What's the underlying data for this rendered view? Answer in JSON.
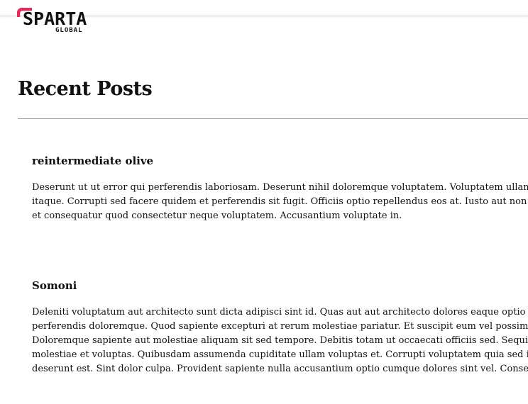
{
  "header": {
    "logo": {
      "word": "SPARTA",
      "sub": "GLOBAL",
      "accent_color": "#e8285a"
    }
  },
  "main": {
    "title": "Recent Posts",
    "posts": [
      {
        "title": "reintermediate olive",
        "lines": [
          "Deserunt ut ut error qui perferendis laboriosam. Deserunt nihil doloremque voluptatem. Voluptatem ullam offici",
          "itaque. Corrupti sed facere quidem et perferendis sit fugit. Officiis optio repellendus eos at. Iusto aut non blandit",
          "et consequatur quod consectetur neque voluptatem. Accusantium voluptate in."
        ]
      },
      {
        "title": "Somoni",
        "lines": [
          "Deleniti voluptatum aut architecto sunt dicta adipisci sint id. Quas aut aut architecto dolores eaque optio quider",
          "perferendis doloremque. Quod sapiente excepturi at rerum molestiae pariatur. Et suscipit eum vel possimus et e",
          "Doloremque sapiente aut molestiae aliquam sit sed tempore. Debitis totam ut occaecati officiis sed. Sequi volup",
          "molestiae et voluptas. Quibusdam assumenda cupiditate ullam voluptas et. Corrupti voluptatem quia sed ipsun",
          "deserunt est. Sint dolor culpa. Provident sapiente nulla accusantium optio cumque dolores sint vel. Consequunt"
        ]
      }
    ]
  }
}
